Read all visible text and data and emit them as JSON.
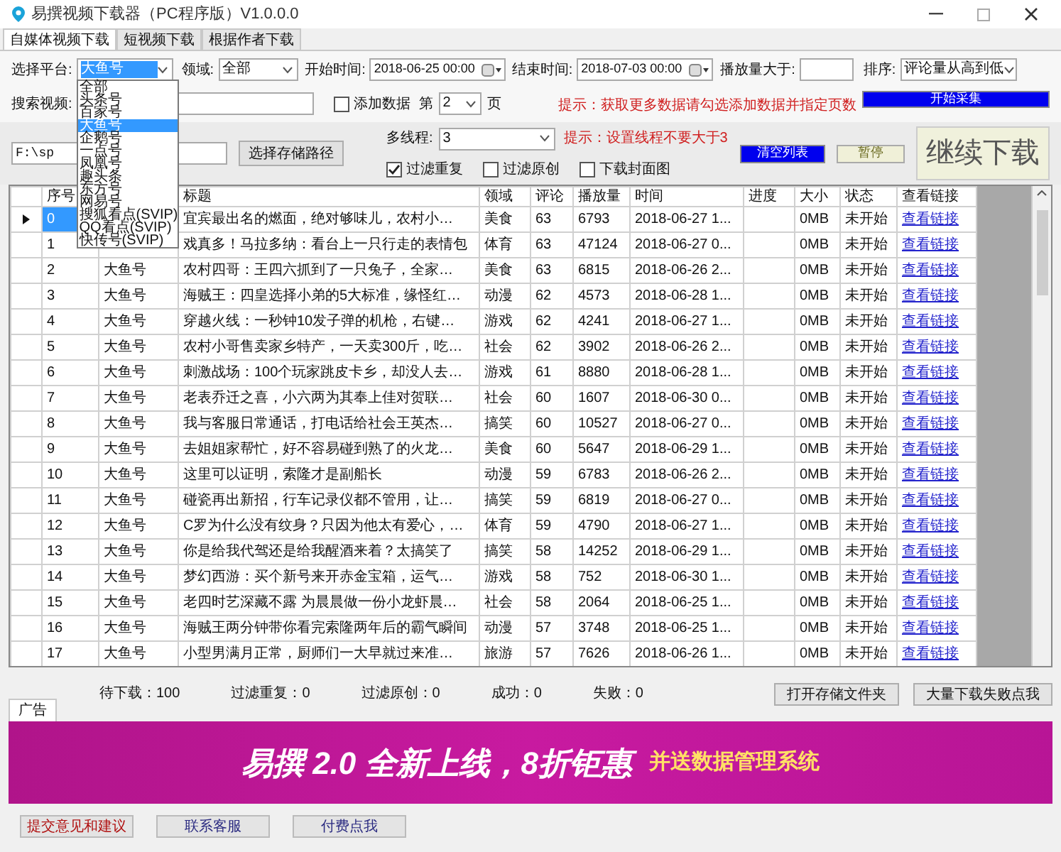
{
  "window": {
    "title": "易撰视频下载器（PC程序版）V1.0.0.0"
  },
  "tabs": [
    {
      "label": "自媒体视频下载",
      "selected": true
    },
    {
      "label": "短视频下载",
      "selected": false
    },
    {
      "label": "根据作者下载",
      "selected": false
    }
  ],
  "filters": {
    "platform_label": "选择平台:",
    "platform_value": "大鱼号",
    "platform_options": [
      {
        "label": "全部",
        "selected": false
      },
      {
        "label": "头条号",
        "selected": false
      },
      {
        "label": "百家号",
        "selected": false
      },
      {
        "label": "大鱼号",
        "selected": true
      },
      {
        "label": "企鹅号",
        "selected": false
      },
      {
        "label": "一点号",
        "selected": false
      },
      {
        "label": "凤凰号",
        "selected": false
      },
      {
        "label": "趣头条",
        "selected": false
      },
      {
        "label": "东方号",
        "selected": false
      },
      {
        "label": "网易号",
        "selected": false
      },
      {
        "label": "搜狐看点(SVIP)",
        "selected": false
      },
      {
        "label": "QQ看点(SVIP)",
        "selected": false
      },
      {
        "label": "快传号(SVIP)",
        "selected": false
      }
    ],
    "field_label": "领域:",
    "field_value": "全部",
    "start_label": "开始时间:",
    "start_value": "2018-06-25 00:00",
    "end_label": "结束时间:",
    "end_value": "2018-07-03 00:00",
    "plays_label": "播放量大于:",
    "sort_label": "排序:",
    "sort_value": "评论量从高到低",
    "search_label": "搜索视频:",
    "add_data": {
      "label": "添加数据",
      "checked": false
    },
    "page_prefix": "第",
    "page_value": "2",
    "page_suffix": "页",
    "hint": "提示：获取更多数据请勾选添加数据并指定页数",
    "start_button": "开始采集"
  },
  "download": {
    "path": "F:\\sp",
    "path_button": "选择存储路径",
    "threads_label": "多线程:",
    "threads_value": "3",
    "hint": "提示：设置线程不要大于3",
    "options": [
      {
        "label": "过滤重复",
        "checked": true
      },
      {
        "label": "过滤原创",
        "checked": false
      },
      {
        "label": "下载封面图",
        "checked": false
      }
    ],
    "clear_button": "清空列表",
    "pause_button": "暂停",
    "resume_button": "继续下载"
  },
  "table": {
    "columns": [
      "序号",
      null,
      "标题",
      "领域",
      "评论",
      "播放量",
      "时间",
      "进度",
      "大小",
      "状态",
      "查看链接"
    ],
    "rows": [
      {
        "selected": true,
        "cells": [
          "0",
          null,
          "宜宾最出名的燃面，绝对够味儿，农村小…",
          "美食",
          "63",
          "6793",
          "2018-06-27 1...",
          null,
          "0MB",
          "未开始",
          "查看链接"
        ]
      },
      {
        "selected": false,
        "cells": [
          "1",
          null,
          "戏真多！马拉多纳：看台上一只行走的表情包",
          "体育",
          "63",
          "47124",
          "2018-06-27 0...",
          null,
          "0MB",
          "未开始",
          "查看链接"
        ]
      },
      {
        "selected": false,
        "cells": [
          "2",
          "大鱼号",
          "农村四哥：王四六抓到了一只兔子，全家…",
          "美食",
          "63",
          "6815",
          "2018-06-26 2...",
          null,
          "0MB",
          "未开始",
          "查看链接"
        ]
      },
      {
        "selected": false,
        "cells": [
          "3",
          "大鱼号",
          "海贼王：四皇选择小弟的5大标准，缘怪红…",
          "动漫",
          "62",
          "4573",
          "2018-06-28 1...",
          null,
          "0MB",
          "未开始",
          "查看链接"
        ]
      },
      {
        "selected": false,
        "cells": [
          "4",
          "大鱼号",
          "穿越火线：一秒钟10发子弹的机枪，右键…",
          "游戏",
          "62",
          "4241",
          "2018-06-27 1...",
          null,
          "0MB",
          "未开始",
          "查看链接"
        ]
      },
      {
        "selected": false,
        "cells": [
          "5",
          "大鱼号",
          "农村小哥售卖家乡特产，一天卖300斤，吃…",
          "社会",
          "62",
          "3902",
          "2018-06-26 2...",
          null,
          "0MB",
          "未开始",
          "查看链接"
        ]
      },
      {
        "selected": false,
        "cells": [
          "6",
          "大鱼号",
          "刺激战场：100个玩家跳皮卡乡，却没人去…",
          "游戏",
          "61",
          "8880",
          "2018-06-28 1...",
          null,
          "0MB",
          "未开始",
          "查看链接"
        ]
      },
      {
        "selected": false,
        "cells": [
          "7",
          "大鱼号",
          "老表乔迁之喜，小六两为其奉上佳对贺联…",
          "社会",
          "60",
          "1607",
          "2018-06-30 0...",
          null,
          "0MB",
          "未开始",
          "查看链接"
        ]
      },
      {
        "selected": false,
        "cells": [
          "8",
          "大鱼号",
          "我与客服日常通话，打电话给社会王英杰…",
          "搞笑",
          "60",
          "10527",
          "2018-06-27 0...",
          null,
          "0MB",
          "未开始",
          "查看链接"
        ]
      },
      {
        "selected": false,
        "cells": [
          "9",
          "大鱼号",
          "去姐姐家帮忙，好不容易碰到熟了的火龙…",
          "美食",
          "60",
          "5647",
          "2018-06-29 1...",
          null,
          "0MB",
          "未开始",
          "查看链接"
        ]
      },
      {
        "selected": false,
        "cells": [
          "10",
          "大鱼号",
          "这里可以证明，索隆才是副船长",
          "动漫",
          "59",
          "6783",
          "2018-06-26 2...",
          null,
          "0MB",
          "未开始",
          "查看链接"
        ]
      },
      {
        "selected": false,
        "cells": [
          "11",
          "大鱼号",
          "碰瓷再出新招，行车记录仪都不管用，让…",
          "搞笑",
          "59",
          "6819",
          "2018-06-27 0...",
          null,
          "0MB",
          "未开始",
          "查看链接"
        ]
      },
      {
        "selected": false,
        "cells": [
          "12",
          "大鱼号",
          "C罗为什么没有纹身？只因为他太有爱心，…",
          "体育",
          "59",
          "4790",
          "2018-06-27 1...",
          null,
          "0MB",
          "未开始",
          "查看链接"
        ]
      },
      {
        "selected": false,
        "cells": [
          "13",
          "大鱼号",
          "你是给我代驾还是给我醒酒来着？太搞笑了",
          "搞笑",
          "58",
          "14252",
          "2018-06-29 1...",
          null,
          "0MB",
          "未开始",
          "查看链接"
        ]
      },
      {
        "selected": false,
        "cells": [
          "14",
          "大鱼号",
          "梦幻西游：买个新号来开赤金宝箱，运气…",
          "游戏",
          "58",
          "752",
          "2018-06-30 1...",
          null,
          "0MB",
          "未开始",
          "查看链接"
        ]
      },
      {
        "selected": false,
        "cells": [
          "15",
          "大鱼号",
          "老四时艺深藏不露 为晨晨做一份小龙虾晨…",
          "社会",
          "58",
          "2064",
          "2018-06-25 1...",
          null,
          "0MB",
          "未开始",
          "查看链接"
        ]
      },
      {
        "selected": false,
        "cells": [
          "16",
          "大鱼号",
          "海贼王两分钟带你看完索隆两年后的霸气瞬间",
          "动漫",
          "57",
          "3748",
          "2018-06-25 1...",
          null,
          "0MB",
          "未开始",
          "查看链接"
        ]
      },
      {
        "selected": false,
        "cells": [
          "17",
          "大鱼号",
          "小型男满月正常，厨师们一大早就过来准…",
          "旅游",
          "57",
          "7626",
          "2018-06-26 1...",
          null,
          "0MB",
          "未开始",
          "查看链接"
        ]
      }
    ]
  },
  "status_bar": {
    "ad_tab": "广告",
    "stats": [
      "待下载：100",
      "过滤重复：0",
      "过滤原创：0",
      "成功：0",
      "失败：0"
    ],
    "buttons": [
      "打开存储文件夹",
      "大量下载失败点我"
    ]
  },
  "ad": {
    "headline": "易撰 2.0 全新上线，8折钜惠",
    "subline": "并送数据管理系统"
  },
  "footer_buttons": [
    "提交意见和建议",
    "联系客服",
    "付费点我"
  ]
}
